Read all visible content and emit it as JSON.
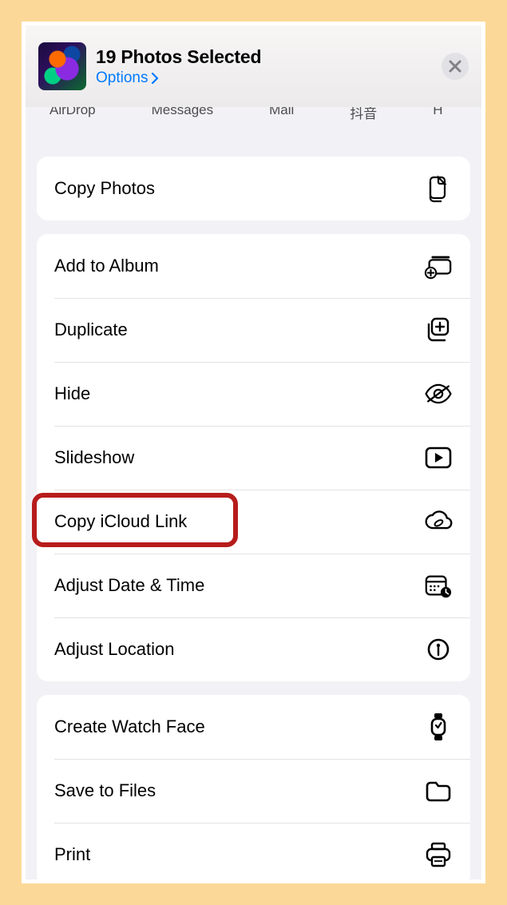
{
  "header": {
    "title": "19 Photos Selected",
    "options_label": "Options"
  },
  "apps": [
    "AirDrop",
    "Messages",
    "Mail",
    "抖音",
    "H"
  ],
  "groups": [
    {
      "items": [
        {
          "label": "Copy Photos",
          "icon": "copy-photos-icon"
        }
      ]
    },
    {
      "items": [
        {
          "label": "Add to Album",
          "icon": "add-to-album-icon"
        },
        {
          "label": "Duplicate",
          "icon": "duplicate-icon"
        },
        {
          "label": "Hide",
          "icon": "hide-icon"
        },
        {
          "label": "Slideshow",
          "icon": "slideshow-icon"
        },
        {
          "label": "Copy iCloud Link",
          "icon": "cloud-link-icon",
          "highlighted": true
        },
        {
          "label": "Adjust Date & Time",
          "icon": "calendar-clock-icon"
        },
        {
          "label": "Adjust Location",
          "icon": "location-pin-icon"
        }
      ]
    },
    {
      "items": [
        {
          "label": "Create Watch Face",
          "icon": "watch-icon"
        },
        {
          "label": "Save to Files",
          "icon": "folder-icon"
        },
        {
          "label": "Print",
          "icon": "printer-icon"
        }
      ]
    }
  ]
}
